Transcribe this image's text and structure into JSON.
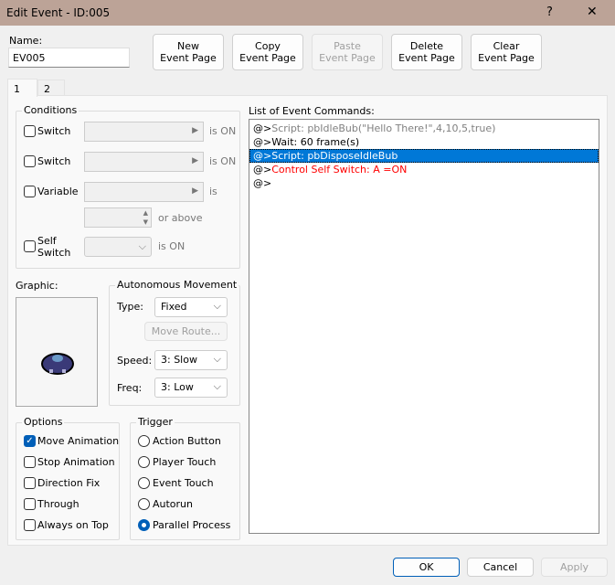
{
  "window": {
    "title": "Edit Event - ID:005",
    "help": "?",
    "close": "✕"
  },
  "name": {
    "label": "Name:",
    "value": "EV005"
  },
  "toolbar": {
    "new": [
      "New",
      "Event Page"
    ],
    "copy": [
      "Copy",
      "Event Page"
    ],
    "paste": [
      "Paste",
      "Event Page"
    ],
    "delete": [
      "Delete",
      "Event Page"
    ],
    "clear": [
      "Clear",
      "Event Page"
    ]
  },
  "tabs": [
    "1",
    "2"
  ],
  "conditions": {
    "title": "Conditions",
    "switch1": "Switch",
    "switch2": "Switch",
    "variable": "Variable",
    "self_switch": [
      "Self",
      "Switch"
    ],
    "is_on": "is ON",
    "is": "is",
    "or_above": "or above"
  },
  "graphic": {
    "label": "Graphic:"
  },
  "autonomous": {
    "title": "Autonomous Movement",
    "type_label": "Type:",
    "type": "Fixed",
    "move_route": "Move Route...",
    "speed_label": "Speed:",
    "speed": "3: Slow",
    "freq_label": "Freq:",
    "freq": "3: Low"
  },
  "options": {
    "title": "Options",
    "items": [
      {
        "label": "Move Animation",
        "checked": true
      },
      {
        "label": "Stop Animation",
        "checked": false
      },
      {
        "label": "Direction Fix",
        "checked": false
      },
      {
        "label": "Through",
        "checked": false
      },
      {
        "label": "Always on Top",
        "checked": false
      }
    ]
  },
  "trigger": {
    "title": "Trigger",
    "items": [
      {
        "label": "Action Button",
        "selected": false
      },
      {
        "label": "Player Touch",
        "selected": false
      },
      {
        "label": "Event Touch",
        "selected": false
      },
      {
        "label": "Autorun",
        "selected": false
      },
      {
        "label": "Parallel Process",
        "selected": true
      }
    ]
  },
  "commands": {
    "label": "List of Event Commands:",
    "items": [
      {
        "prefix": "@>",
        "text": "Script: pbIdleBub(\"Hello There!\",4,10,5,true)",
        "color": "#808080"
      },
      {
        "prefix": "@>",
        "text": "Wait: 60 frame(s)",
        "color": "#000000"
      },
      {
        "prefix": "@>",
        "text": "Script: pbDisposeIdleBub",
        "color": "#ffffff",
        "selected": true
      },
      {
        "prefix": "@>",
        "text": "Control Self Switch: A =ON",
        "color": "#ff0000"
      },
      {
        "prefix": "@>",
        "text": "",
        "color": "#000000"
      }
    ]
  },
  "footer": {
    "ok": "OK",
    "cancel": "Cancel",
    "apply": "Apply"
  },
  "colors": {
    "titlebar": "#bca397",
    "selection": "#0078d7",
    "accent": "#005fb8"
  }
}
